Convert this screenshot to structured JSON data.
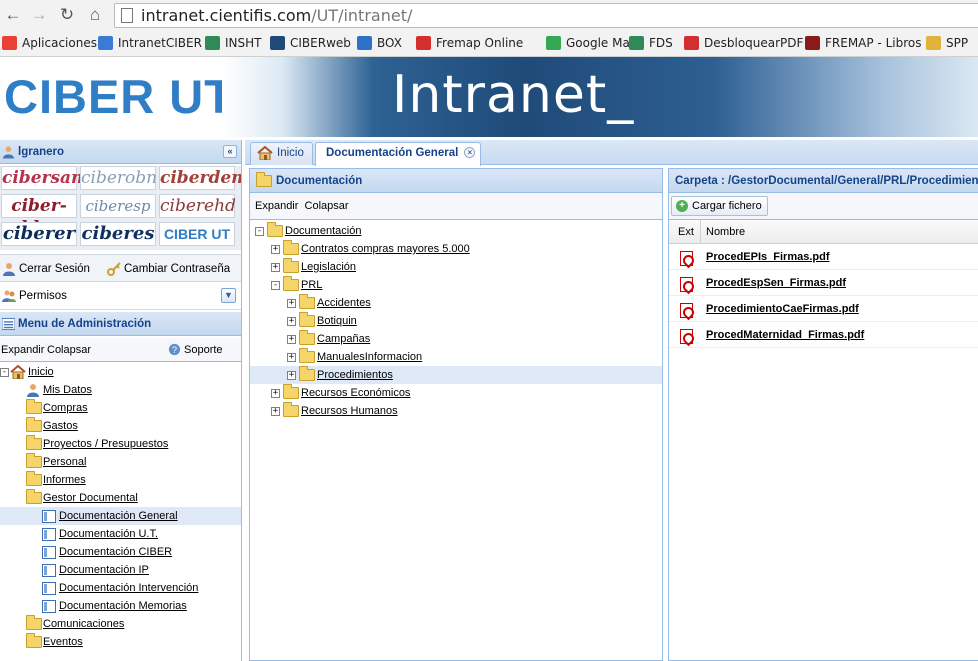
{
  "browser": {
    "url_host": "intranet.cientifis.com",
    "url_path": "/UT/intranet/",
    "bookmarks": [
      {
        "label": "Aplicaciones",
        "icon": "apps-grid-icon",
        "color": "#e94235"
      },
      {
        "label": "IntranetCIBER",
        "icon": "globe-icon",
        "color": "#3a7bd5"
      },
      {
        "label": "INSHT",
        "icon": "insht-icon",
        "color": "#2e8b57"
      },
      {
        "label": "CIBERweb",
        "icon": "dots-icon",
        "color": "#1f4a78"
      },
      {
        "label": "BOX",
        "icon": "box-icon",
        "color": "#2a73c5"
      },
      {
        "label": "Fremap Online",
        "icon": "fremap-icon",
        "color": "#d32f2f"
      },
      {
        "label": "Google Maps",
        "icon": "maps-icon",
        "color": "#34a853"
      },
      {
        "label": "FDS",
        "icon": "fds-icon",
        "color": "#2e8b57"
      },
      {
        "label": "DesbloquearPDF",
        "icon": "pdf-icon",
        "color": "#d32f2f"
      },
      {
        "label": "FREMAP - Libros",
        "icon": "fremap-books-icon",
        "color": "#8b1a1a"
      },
      {
        "label": "SPP",
        "icon": "folder-icon",
        "color": "#e0b43a"
      }
    ]
  },
  "header": {
    "logo": "CIBER UT",
    "banner": "Intranet_"
  },
  "left": {
    "user": "lgranero",
    "logos": [
      "cibersam",
      "ciberobn",
      "ciberdem",
      "ciber-bbn",
      "ciberesp",
      "ciberehd",
      "ciberer",
      "ciberes",
      "CIBER UT"
    ],
    "logout": "Cerrar Sesión",
    "change_password": "Cambiar Contraseña",
    "permissions": "Permisos",
    "menu_title": "Menu de Administración",
    "expand": "Expandir",
    "collapse": "Colapsar",
    "support": "Soporte",
    "tree": [
      {
        "label": "Inicio",
        "level": 0,
        "type": "home",
        "exp": "-"
      },
      {
        "label": "Mis Datos",
        "level": 1,
        "type": "person"
      },
      {
        "label": "Compras",
        "level": 1,
        "type": "folder",
        "exp": "+"
      },
      {
        "label": "Gastos",
        "level": 1,
        "type": "folder",
        "exp": "+"
      },
      {
        "label": "Proyectos / Presupuestos",
        "level": 1,
        "type": "folder",
        "exp": "+"
      },
      {
        "label": "Personal",
        "level": 1,
        "type": "folder",
        "exp": "+"
      },
      {
        "label": "Informes",
        "level": 1,
        "type": "folder",
        "exp": "+"
      },
      {
        "label": "Gestor Documental",
        "level": 1,
        "type": "folder",
        "exp": "-"
      },
      {
        "label": "Documentación General",
        "level": 2,
        "type": "doc",
        "selected": true
      },
      {
        "label": "Documentación U.T.",
        "level": 2,
        "type": "doc"
      },
      {
        "label": "Documentación CIBER",
        "level": 2,
        "type": "doc"
      },
      {
        "label": "Documentación IP",
        "level": 2,
        "type": "doc"
      },
      {
        "label": "Documentación Intervención",
        "level": 2,
        "type": "doc"
      },
      {
        "label": "Documentación Memorias",
        "level": 2,
        "type": "doc"
      },
      {
        "label": "Comunicaciones",
        "level": 1,
        "type": "folder",
        "exp": "+"
      },
      {
        "label": "Eventos",
        "level": 1,
        "type": "folder",
        "exp": "+"
      }
    ]
  },
  "tabs": [
    {
      "label": "Inicio",
      "active": false
    },
    {
      "label": "Documentación General",
      "active": true
    }
  ],
  "middle": {
    "title": "Documentación",
    "expand": "Expandir",
    "collapse": "Colapsar",
    "tree": [
      {
        "label": "Documentación",
        "level": 0,
        "exp": "-"
      },
      {
        "label": "Contratos compras mayores 5.000",
        "level": 1,
        "exp": "+"
      },
      {
        "label": "Legislación",
        "level": 1,
        "exp": "+"
      },
      {
        "label": "PRL",
        "level": 1,
        "exp": "-"
      },
      {
        "label": "Accidentes",
        "level": 2,
        "exp": "+"
      },
      {
        "label": "Botiquin",
        "level": 2,
        "exp": "+"
      },
      {
        "label": "Campañas",
        "level": 2,
        "exp": "+"
      },
      {
        "label": "ManualesInformacion",
        "level": 2,
        "exp": "+"
      },
      {
        "label": "Procedimientos",
        "level": 2,
        "exp": "+",
        "selected": true
      },
      {
        "label": "Recursos Económicos",
        "level": 1,
        "exp": "+"
      },
      {
        "label": "Recursos Humanos",
        "level": 1,
        "exp": "+"
      }
    ]
  },
  "right": {
    "title": "Carpeta : /GestorDocumental/General/PRL/Procedimientos",
    "upload": "Cargar fichero",
    "col_ext": "Ext",
    "col_name": "Nombre",
    "files": [
      "ProcedEPIs_Firmas.pdf",
      "ProcedEspSen_Firmas.pdf",
      "ProcedimientoCaeFirmas.pdf",
      "ProcedMaternidad_Firmas.pdf"
    ]
  }
}
